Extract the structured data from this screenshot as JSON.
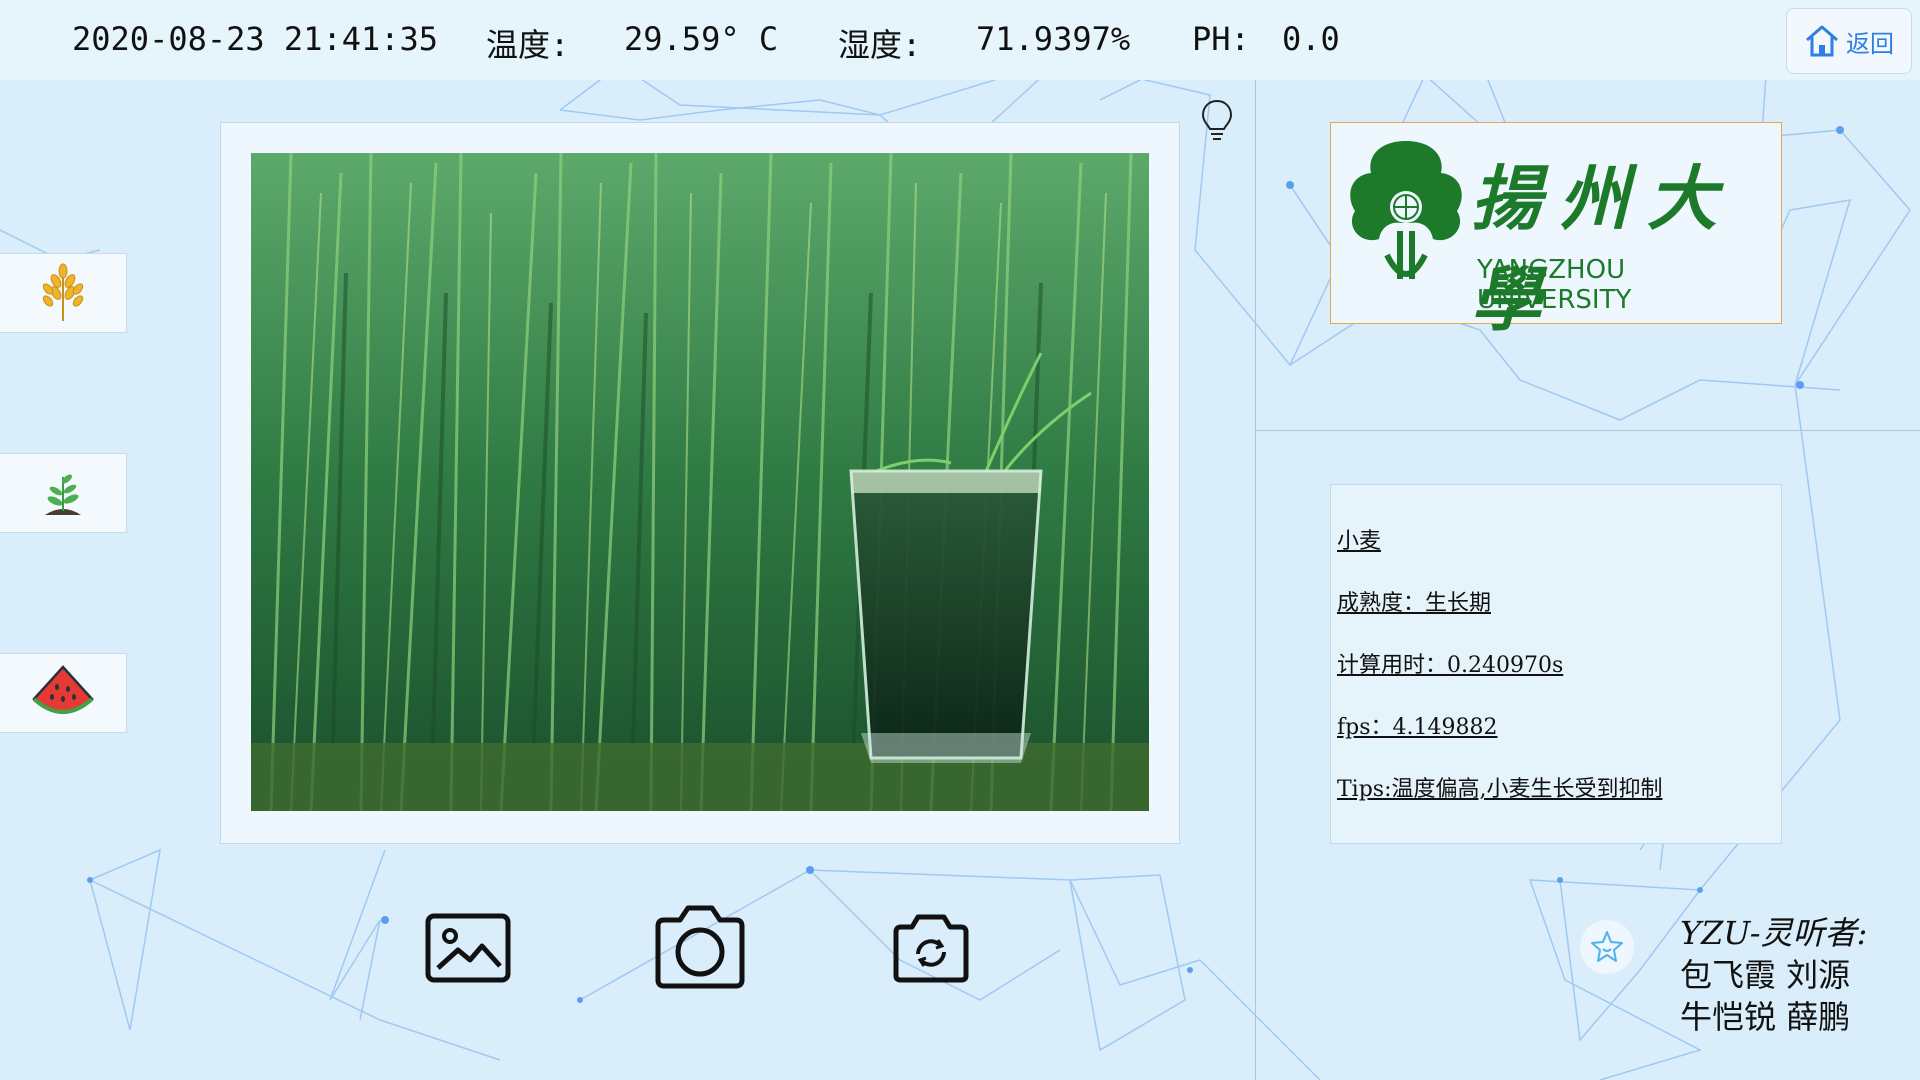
{
  "status": {
    "datetime": "2020-08-23 21:41:35",
    "temperature_label": "温度:",
    "temperature_value": "29.59° C",
    "humidity_label": "湿度:",
    "humidity_value": "71.9397%",
    "ph_label": "PH:",
    "ph_value": "0.0"
  },
  "back_button": {
    "label": "返回",
    "icon": "home-icon"
  },
  "side_nav": [
    {
      "icon": "wheat-icon"
    },
    {
      "icon": "seedling-icon"
    },
    {
      "icon": "watermelon-icon"
    }
  ],
  "logo": {
    "cn": "揚州大學",
    "en": "YANGZHOU UNIVERSITY"
  },
  "result": {
    "crop": "小麦",
    "maturity": "成熟度：生长期",
    "time": "计算用时：0.240970s",
    "fps": "fps：4.149882",
    "tips": "Tips:温度偏高,小麦生长受到抑制"
  },
  "credits": {
    "line1": "YZU-灵听者:",
    "line2": "包飞霞 刘源",
    "line3": "牛恺锐 薛鹏"
  },
  "colors": {
    "accent": "#2e7fe0",
    "brand_green": "#1d7a2a",
    "logo_border": "#e8a84e",
    "background": "#d9eefa"
  }
}
